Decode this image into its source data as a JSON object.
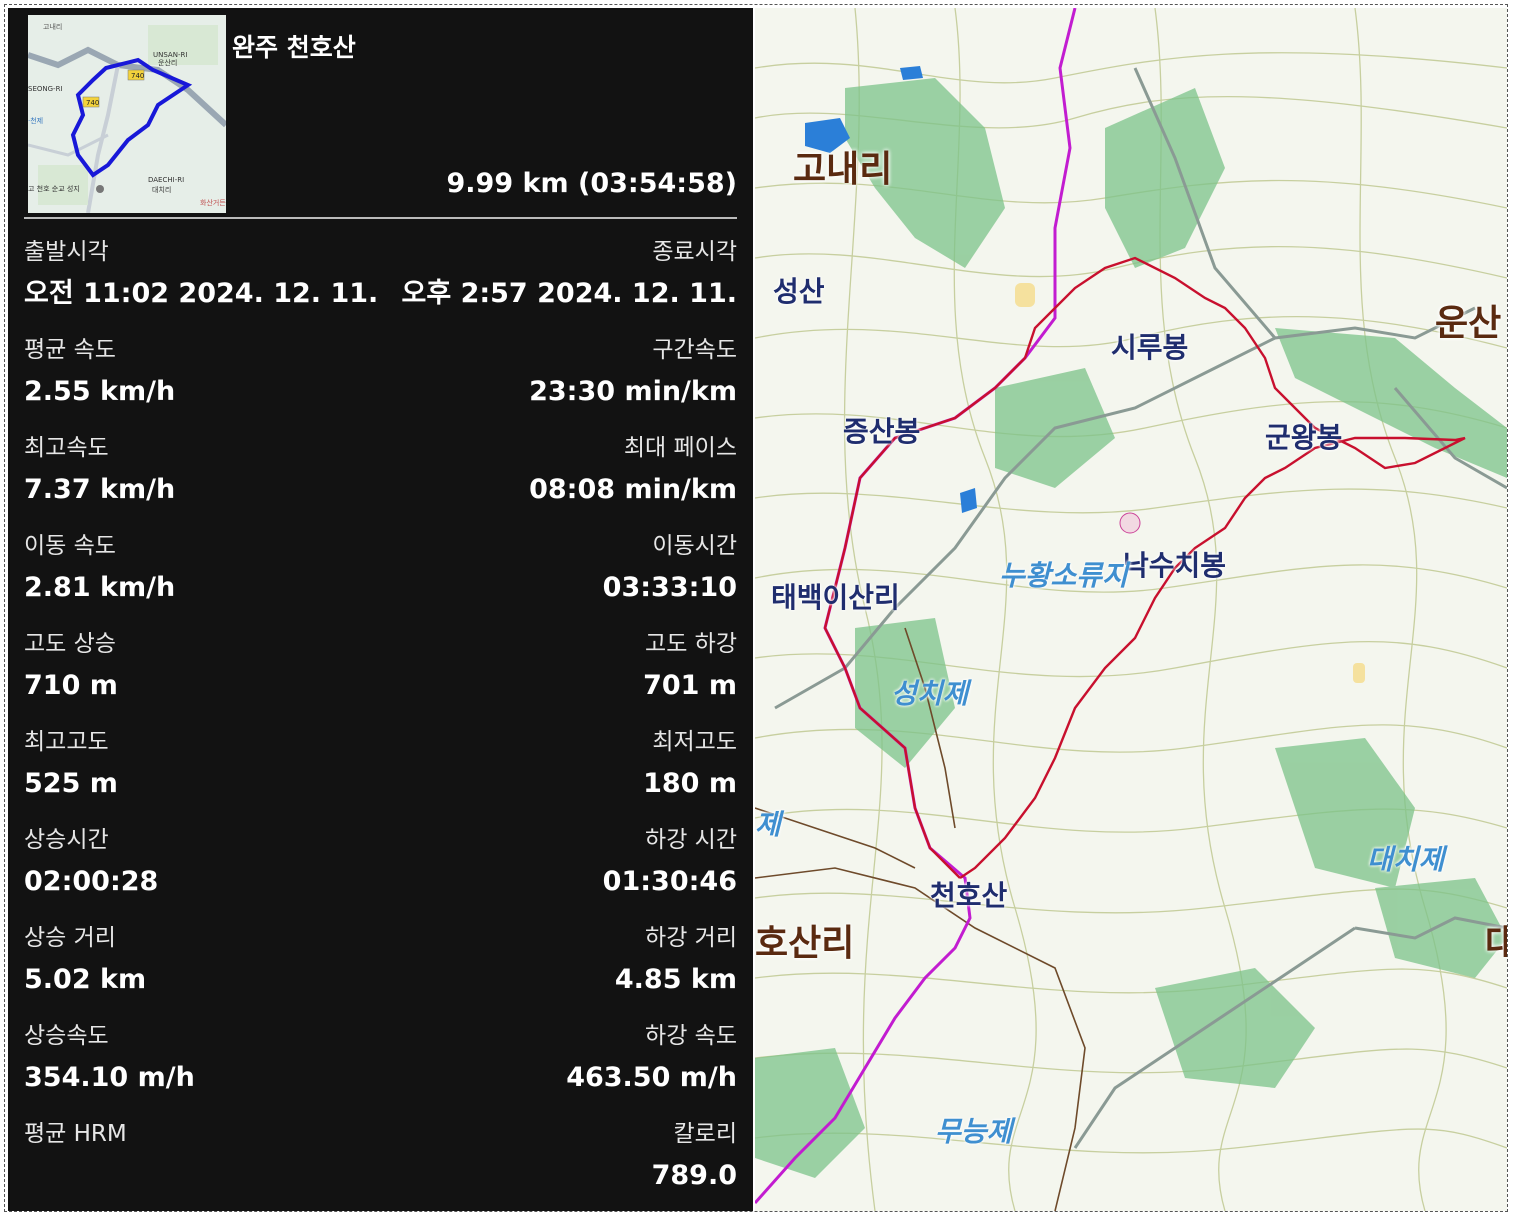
{
  "activity": {
    "title": "완주 천호산",
    "summary": "9.99 km (03:54:58)"
  },
  "thumbnail": {
    "labels": {
      "goneri": "고내리",
      "unsan_ri": "UNSAN-RI",
      "unsan_ri_kr": "운산리",
      "road_top": "740",
      "road_mid": "740",
      "seong_ri": "SEONG-RI",
      "jeongje": "·천제",
      "cheonho": "고 천호 순교 성지",
      "daechi_ri": "DAECHI-RI",
      "daechi_ri_kr": "대치리",
      "hwasan": "화산거든"
    }
  },
  "stats": [
    {
      "left_label": "출발시각",
      "left_value": "오전 11:02 2024. 12. 11.",
      "right_label": "종료시각",
      "right_value": "오후 2:57 2024. 12. 11."
    },
    {
      "left_label": "평균 속도",
      "left_value": "2.55 km/h",
      "right_label": "구간속도",
      "right_value": "23:30 min/km"
    },
    {
      "left_label": "최고속도",
      "left_value": "7.37 km/h",
      "right_label": "최대 페이스",
      "right_value": "08:08 min/km"
    },
    {
      "left_label": "이동 속도",
      "left_value": "2.81 km/h",
      "right_label": "이동시간",
      "right_value": "03:33:10"
    },
    {
      "left_label": "고도 상승",
      "left_value": "710 m",
      "right_label": "고도 하강",
      "right_value": "701 m"
    },
    {
      "left_label": "최고고도",
      "left_value": "525 m",
      "right_label": "최저고도",
      "right_value": "180 m"
    },
    {
      "left_label": "상승시간",
      "left_value": "02:00:28",
      "right_label": "하강 시간",
      "right_value": "01:30:46"
    },
    {
      "left_label": "상승 거리",
      "left_value": "5.02 km",
      "right_label": "하강 거리",
      "right_value": "4.85 km"
    },
    {
      "left_label": "상승속도",
      "left_value": "354.10 m/h",
      "right_label": "하강 속도",
      "right_value": "463.50 m/h"
    },
    {
      "left_label": "평균 HRM",
      "left_value": "",
      "right_label": "칼로리",
      "right_value": "789.0"
    }
  ],
  "map": {
    "labels": {
      "goneri": "고내리",
      "seongsan": "성산",
      "sirubong": "시루봉",
      "unsan": "운산",
      "jeungsanbong": "증산봉",
      "gunwangbong": "군왕봉",
      "nakkuchibong": "낙수치봉",
      "nuhwang": "누황소류지",
      "taebaek": "태백이산리",
      "seongchije": "성치제",
      "je_left": "제",
      "daechije": "대치제",
      "cheonhosan": "천호산",
      "hosanri": "호산리",
      "da_edge": "대",
      "muneungje": "무능제"
    },
    "colors": {
      "track": "#c8102e",
      "boundary": "#d020c8",
      "forest": "#4aa56a",
      "contour": "#b8c89a",
      "water": "#2b7fd8"
    }
  }
}
